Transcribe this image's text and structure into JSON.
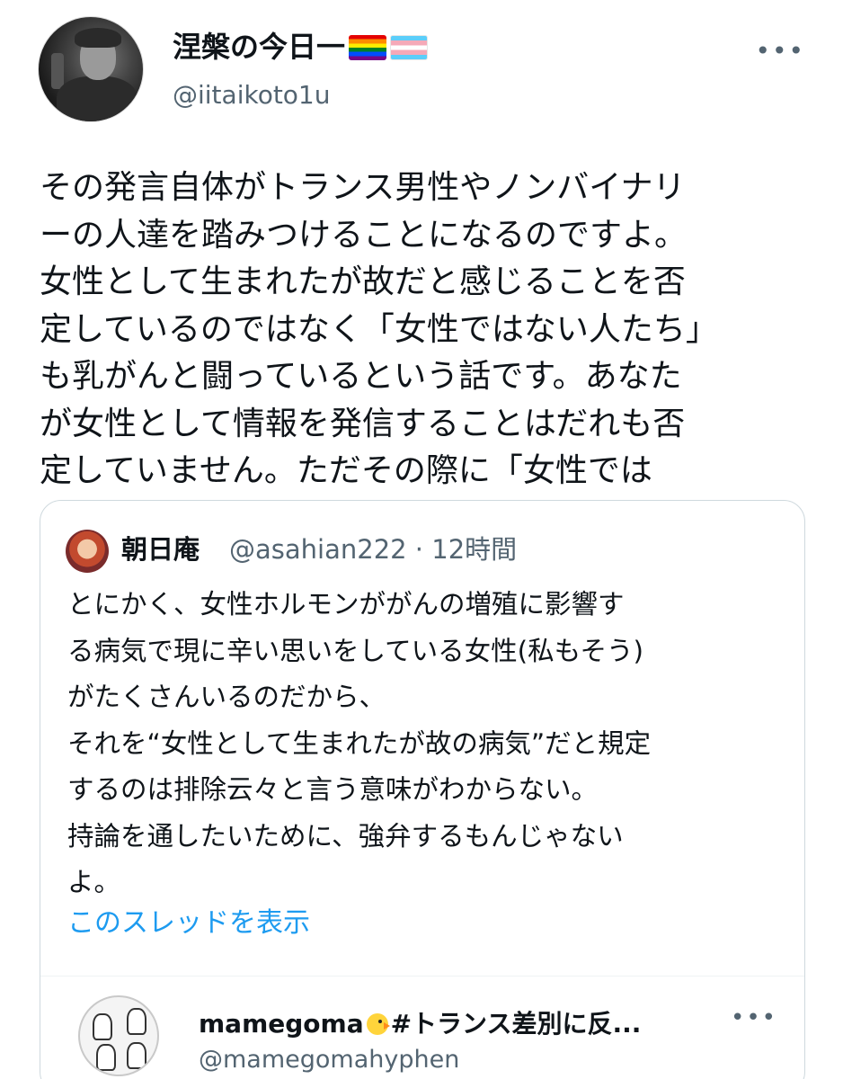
{
  "tweet": {
    "display_name": "涅槃の今日一",
    "handle": "@iitaikoto1u",
    "more_label": "•••",
    "text_lines": [
      "その発言自体がトランス男性やノンバイナリ",
      "ーの人達を踏みつけることになるのですよ。",
      "女性として生まれたが故だと感じることを否",
      "定しているのではなく「女性ではない人たち」",
      "も乳がんと闘っているという話です。あなた",
      "が女性として情報を発信することはだれも否",
      "定していません。ただその際に「女性では"
    ]
  },
  "quote": {
    "name": "朝日庵",
    "handle_time": "@asahian222 · 12時間",
    "text_lines": [
      "とにかく、女性ホルモンががんの増殖に影響す",
      "る病気で現に辛い思いをしている女性(私もそう)",
      "がたくさんいるのだから、",
      "それを“女性として生まれたが故の病気”だと規定",
      "するのは排除云々と言う意味がわからない。",
      "持論を通したいために、強弁するもんじゃない",
      "よ。"
    ],
    "thread_link": "このスレッドを表示"
  },
  "next_tweet": {
    "name_prefix": "mamegoma",
    "name_suffix": "#トランス差別に反...",
    "handle": "@mamegomahyphen",
    "more_label": "•••"
  },
  "colors": {
    "text": "#0f1419",
    "secondary": "#536471",
    "link": "#1d9bf0",
    "border": "#cfd9de"
  },
  "icons": [
    "rainbow-flag-icon",
    "transgender-flag-icon",
    "more-icon",
    "chick-icon"
  ]
}
